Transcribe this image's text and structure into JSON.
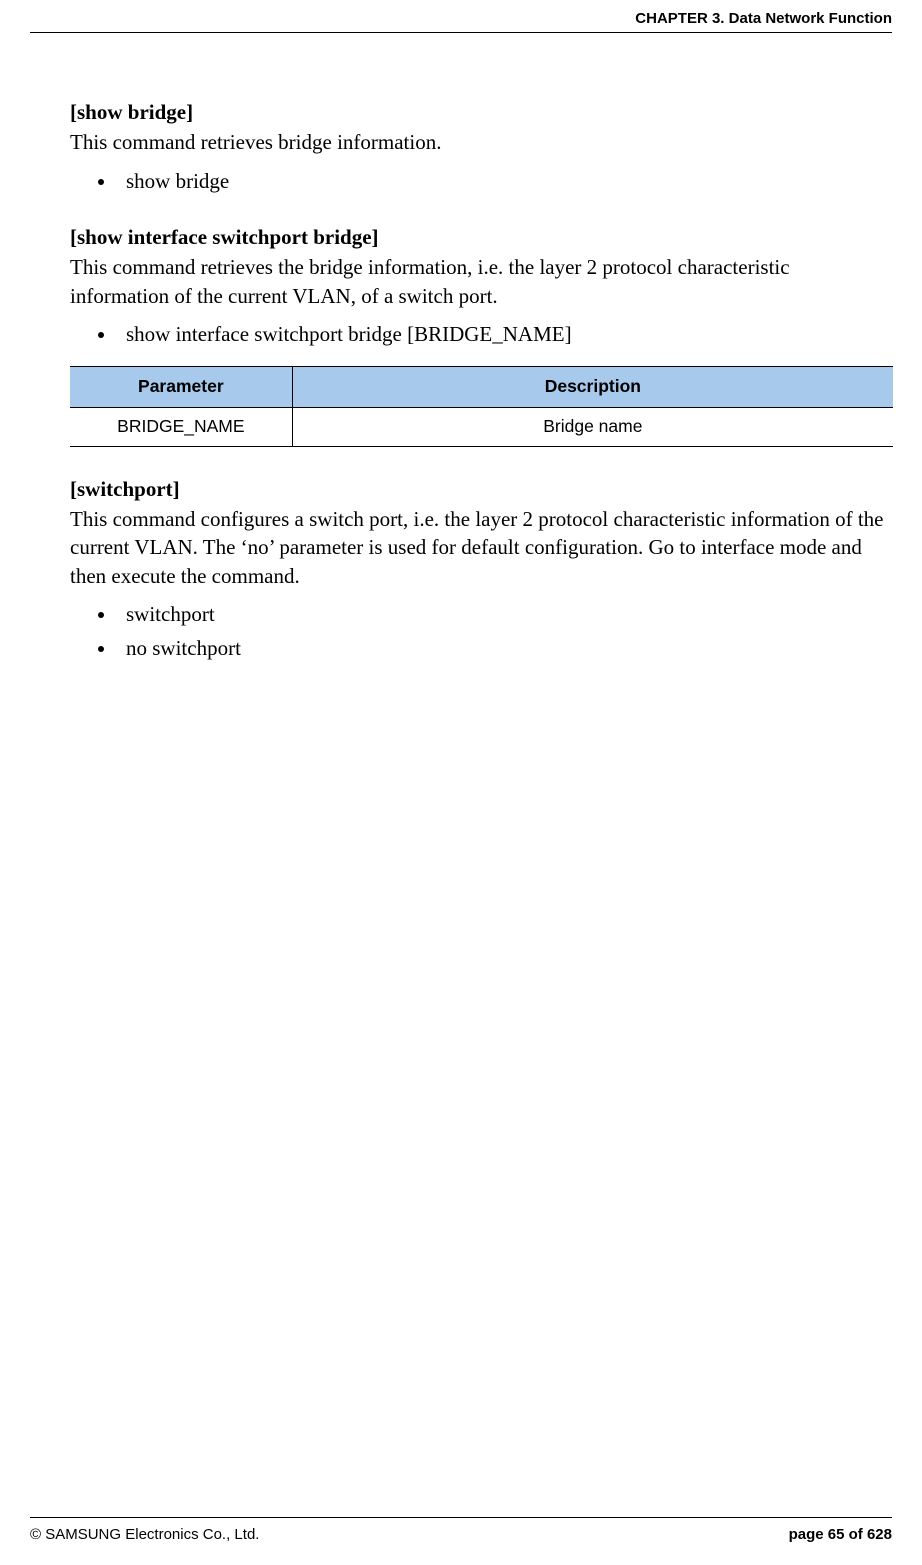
{
  "header": {
    "chapter": "CHAPTER 3. Data Network Function"
  },
  "sections": [
    {
      "title": "[show bridge]",
      "desc": "This command retrieves bridge information.",
      "bullets": [
        "show bridge"
      ]
    },
    {
      "title": "[show interface switchport bridge]",
      "desc": "This command retrieves the bridge information, i.e. the layer 2 protocol characteristic information of the current VLAN, of a switch port.",
      "bullets": [
        "show interface switchport bridge [BRIDGE_NAME]"
      ],
      "table": {
        "headers": [
          "Parameter",
          "Description"
        ],
        "rows": [
          [
            "BRIDGE_NAME",
            "Bridge name"
          ]
        ]
      }
    },
    {
      "title": "[switchport]",
      "desc": "This command configures a switch port, i.e. the layer 2 protocol characteristic information of the current VLAN. The ‘no’ parameter is used for default configuration. Go to interface mode and then execute the command.",
      "bullets": [
        "switchport",
        "no switchport"
      ]
    }
  ],
  "footer": {
    "copyright": "© SAMSUNG Electronics Co., Ltd.",
    "page": "page 65 of 628"
  }
}
